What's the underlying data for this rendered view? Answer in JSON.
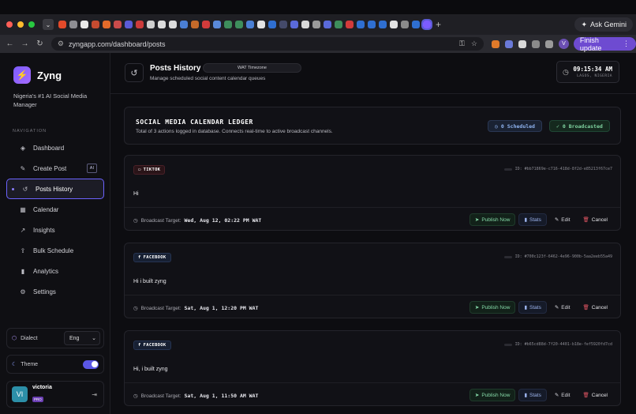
{
  "browser": {
    "gemini_label": "Ask Gemini",
    "url": "zyngapp.com/dashboard/posts",
    "finish_update_label": "Finish update",
    "profile_initial": "V"
  },
  "colors": {
    "accent": "#6c63ff",
    "success": "#7fd3a0",
    "danger": "#e05563",
    "info": "#8fb3f0"
  },
  "sidebar": {
    "brand": "Zyng",
    "tagline": "Nigeria's #1 AI Social Media Manager",
    "nav_label": "NAVIGATION",
    "items": [
      {
        "label": "Dashboard",
        "icon": "dashboard-icon"
      },
      {
        "label": "Create Post",
        "icon": "edit-icon",
        "badge": "AI"
      },
      {
        "label": "Posts History",
        "icon": "history-icon",
        "active": true
      },
      {
        "label": "Calendar",
        "icon": "calendar-icon"
      },
      {
        "label": "Insights",
        "icon": "trend-icon"
      },
      {
        "label": "Bulk Schedule",
        "icon": "upload-icon"
      },
      {
        "label": "Analytics",
        "icon": "bar-chart-icon"
      },
      {
        "label": "Settings",
        "icon": "gear-icon"
      }
    ],
    "dialect_label": "Dialect",
    "dialect_value": "Eng",
    "theme_label": "Theme",
    "user_initials": "VI",
    "user_name": "victoria",
    "user_badge": "PRO"
  },
  "header": {
    "title": "Posts History",
    "timezone": "WAT Timezone",
    "subtitle": "Manage scheduled social content calendar queues",
    "time": "09:15:34 AM",
    "location": "LAGOS, NIGERIA"
  },
  "ledger": {
    "title": "SOCIAL MEDIA CALENDAR LEDGER",
    "subtitle": "Total of 3 actions logged in database. Connects real-time to active broadcast channels.",
    "scheduled": "0 Scheduled",
    "broadcasted": "0 Broadcasted"
  },
  "labels": {
    "broadcast_target": "Broadcast Target:",
    "publish": "Publish Now",
    "stats": "Stats",
    "edit": "Edit",
    "cancel": "Cancel"
  },
  "posts": [
    {
      "platform": "TIKTOK",
      "id": "ID: #bb71869e-c716-418d-8f2d-e85213f67ce7",
      "content": "Hi",
      "target": "Wed, Aug 12, 02:22 PM WAT"
    },
    {
      "platform": "FACEBOOK",
      "id": "ID: #700c123f-6462-4e96-900b-5aa2eeb55a49",
      "content": "Hi i built zyng",
      "target": "Sat, Aug 1, 12:20 PM WAT"
    },
    {
      "platform": "FACEBOOK",
      "id": "ID: #b65cd88d-7f20-4401-b18e-fef5920fd7cd",
      "content": "Hi, i built zyng",
      "target": "Sat, Aug 1, 11:50 AM WAT"
    }
  ]
}
